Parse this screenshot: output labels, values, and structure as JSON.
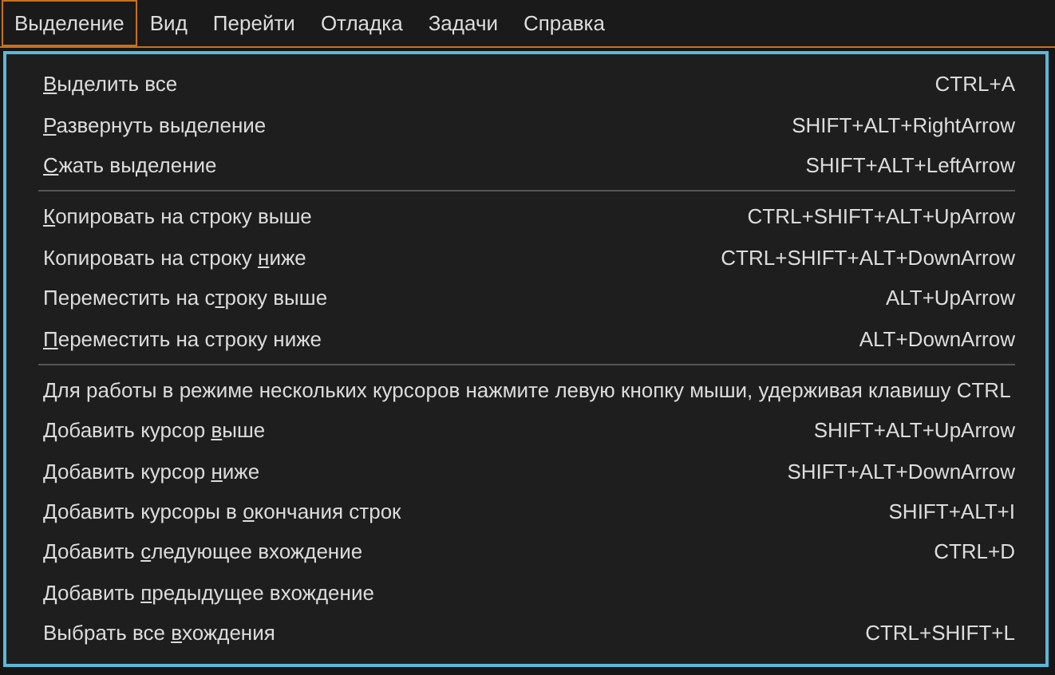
{
  "menubar": [
    {
      "label": "Выделение",
      "selected": true
    },
    {
      "label": "Вид",
      "selected": false
    },
    {
      "label": "Перейти",
      "selected": false
    },
    {
      "label": "Отладка",
      "selected": false
    },
    {
      "label": "Задачи",
      "selected": false
    },
    {
      "label": "Справка",
      "selected": false
    }
  ],
  "menu": {
    "groups": [
      [
        {
          "key": "В",
          "after": "ыделить все",
          "shortcut": "CTRL+A"
        },
        {
          "key": "Р",
          "after": "азвернуть выделение",
          "shortcut": "SHIFT+ALT+RightArrow"
        },
        {
          "key": "С",
          "after": "жать выделение",
          "shortcut": "SHIFT+ALT+LeftArrow"
        }
      ],
      [
        {
          "key": "К",
          "after": "опировать на строку выше",
          "shortcut": "CTRL+SHIFT+ALT+UpArrow"
        },
        {
          "before": "Копировать на строку ",
          "key": "н",
          "after": "иже",
          "shortcut": "CTRL+SHIFT+ALT+DownArrow"
        },
        {
          "before": "Переместить на с",
          "key": "т",
          "after": "року выше",
          "shortcut": "ALT+UpArrow"
        },
        {
          "key": "П",
          "after": "ереместить на строку ниже",
          "shortcut": "ALT+DownArrow"
        }
      ],
      [
        {
          "before": "Для работы в режиме нескольких курсоров нажмите левую кнопку мыши, удерживая клавишу CTRL"
        },
        {
          "before": "Добавить курсор ",
          "key": "в",
          "after": "ыше",
          "shortcut": "SHIFT+ALT+UpArrow"
        },
        {
          "before": "Добавить курсор ",
          "key": "н",
          "after": "иже",
          "shortcut": "SHIFT+ALT+DownArrow"
        },
        {
          "before": "Добавить курсоры в ",
          "key": "о",
          "after": "кончания строк",
          "shortcut": "SHIFT+ALT+I"
        },
        {
          "before": "Добавить ",
          "key": "с",
          "after": "ледующее вхождение",
          "shortcut": "CTRL+D"
        },
        {
          "before": "Добавить ",
          "key": "п",
          "after": "редыдущее вхождение"
        },
        {
          "before": "Выбрать все ",
          "key": "в",
          "after": "хождения",
          "shortcut": "CTRL+SHIFT+L"
        }
      ]
    ]
  }
}
